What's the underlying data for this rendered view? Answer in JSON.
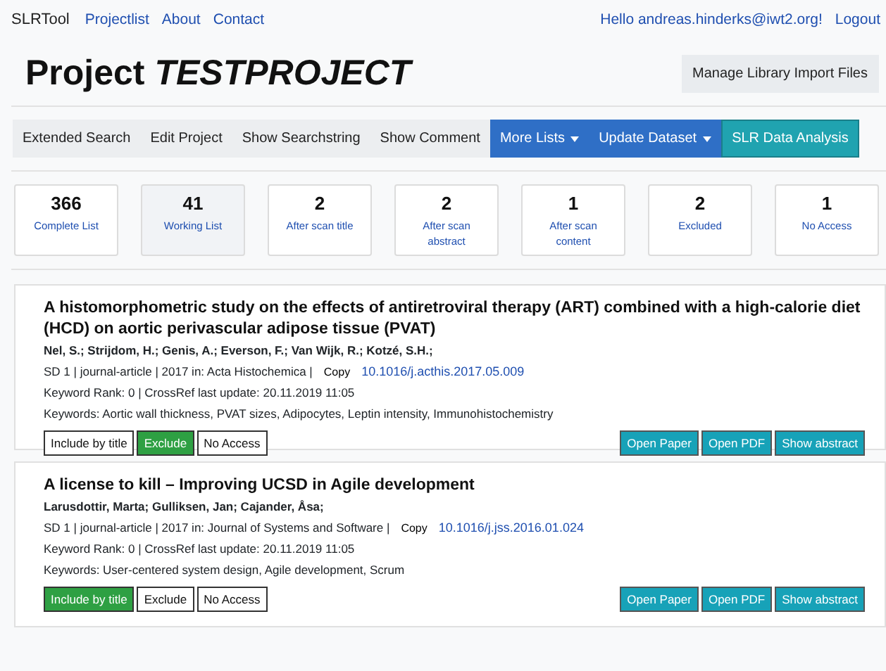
{
  "navbar": {
    "brand": "SLRTool",
    "links": [
      "Projectlist",
      "About",
      "Contact"
    ],
    "greeting": "Hello andreas.hinderks@iwt2.org!",
    "logout": "Logout"
  },
  "header": {
    "title_prefix": "Project",
    "title_name": "TESTPROJECT",
    "button": "Manage Library Import Files"
  },
  "toolbar": [
    {
      "label": "Extended Search",
      "kind": "plain"
    },
    {
      "label": "Edit Project",
      "kind": "plain"
    },
    {
      "label": "Show Searchstring",
      "kind": "plain"
    },
    {
      "label": "Show Comment",
      "kind": "plain"
    },
    {
      "label": "More Lists",
      "kind": "dropdown"
    },
    {
      "label": "Update Dataset",
      "kind": "dropdown"
    },
    {
      "label": "SLR Data Analysis",
      "kind": "accent"
    }
  ],
  "lists": [
    {
      "count": "366",
      "label": "Complete List",
      "selected": false
    },
    {
      "count": "41",
      "label": "Working List",
      "selected": true
    },
    {
      "count": "2",
      "label": "After scan title",
      "selected": false
    },
    {
      "count": "2",
      "label": "After scan abstract",
      "selected": false
    },
    {
      "count": "1",
      "label": "After scan content",
      "selected": false
    },
    {
      "count": "2",
      "label": "Excluded",
      "selected": false
    },
    {
      "count": "1",
      "label": "No Access",
      "selected": false
    }
  ],
  "papers": [
    {
      "title": "A histomorphometric study on the effects of antiretroviral therapy (ART) combined with a high-calorie diet (HCD) on aortic perivascular adipose tissue (PVAT)",
      "authors": "Nel, S.; Strijdom, H.; Genis, A.; Everson, F.; Van Wijk, R.; Kotzé, S.H.;",
      "meta": "SD 1 | journal-article | 2017 in: Acta Histochemica |",
      "copy": "Copy",
      "doi": "10.1016/j.acthis.2017.05.009",
      "rank": "Keyword Rank: 0 | CrossRef last update: 20.11.2019 11:05",
      "keywords": "Keywords: Aortic wall thickness, PVAT sizes, Adipocytes, Leptin intensity, Immunohistochemistry",
      "decisions": [
        {
          "label": "Include by title",
          "selected": false
        },
        {
          "label": "Exclude",
          "selected": true
        },
        {
          "label": "No Access",
          "selected": false
        }
      ],
      "actions": [
        "Open Paper",
        "Open PDF",
        "Show abstract"
      ]
    },
    {
      "title": "A license to kill – Improving UCSD in Agile development",
      "authors": "Larusdottir, Marta; Gulliksen, Jan; Cajander, Åsa;",
      "meta": "SD 1 | journal-article | 2017 in: Journal of Systems and Software |",
      "copy": "Copy",
      "doi": "10.1016/j.jss.2016.01.024",
      "rank": "Keyword Rank: 0 | CrossRef last update: 20.11.2019 11:05",
      "keywords": "Keywords: User-centered system design, Agile development, Scrum",
      "decisions": [
        {
          "label": "Include by title",
          "selected": true
        },
        {
          "label": "Exclude",
          "selected": false
        },
        {
          "label": "No Access",
          "selected": false
        }
      ],
      "actions": [
        "Open Paper",
        "Open PDF",
        "Show abstract"
      ]
    }
  ]
}
